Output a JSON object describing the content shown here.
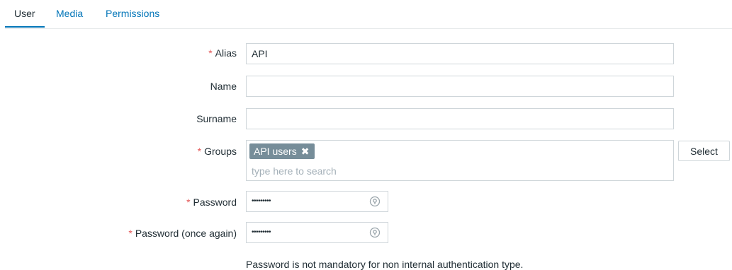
{
  "tabs": [
    {
      "label": "User",
      "active": true
    },
    {
      "label": "Media",
      "active": false
    },
    {
      "label": "Permissions",
      "active": false
    }
  ],
  "form": {
    "required_marker": "*",
    "alias": {
      "label": "Alias",
      "value": "API",
      "required": true
    },
    "name": {
      "label": "Name",
      "value": "",
      "required": false
    },
    "surname": {
      "label": "Surname",
      "value": "",
      "required": false
    },
    "groups": {
      "label": "Groups",
      "required": true,
      "selected": [
        {
          "label": "API users",
          "remove_icon": "close-icon"
        }
      ],
      "remove_glyph": "✖",
      "placeholder": "type here to search",
      "select_button": "Select"
    },
    "password": {
      "label": "Password",
      "value": "•••••••••",
      "required": true,
      "icon": "password-eye-icon"
    },
    "password_again": {
      "label": "Password (once again)",
      "value": "•••••••••",
      "required": true,
      "icon": "password-eye-icon"
    },
    "password_hint": "Password is not mandatory for non internal authentication type."
  },
  "colors": {
    "link": "#0275b8",
    "required": "#e45959",
    "chip_bg": "#768d99",
    "border": "#cfd6da"
  }
}
